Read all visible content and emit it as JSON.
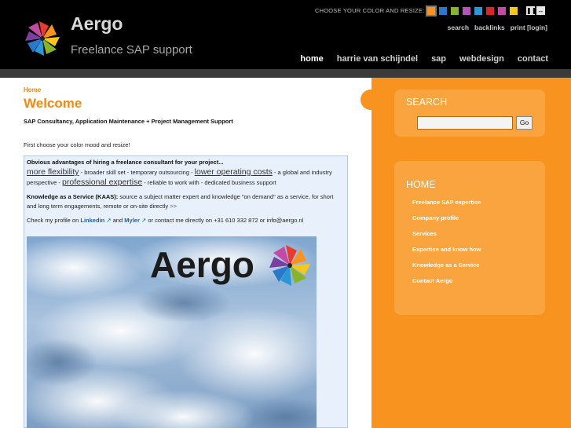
{
  "colors": {
    "accent": "#f7931e",
    "swatches": [
      "#f7931e",
      "#2a78c9",
      "#86b52a",
      "#b255b5",
      "#2a97d9",
      "#d4262b",
      "#c54aa3",
      "#f4c81c"
    ]
  },
  "header": {
    "site_title": "Aergo",
    "slogan": "Freelance SAP support",
    "color_label": "CHOOSE YOUR COLOR AND RESIZE:",
    "meta_nav": [
      "search",
      "backlinks",
      "print [login]"
    ],
    "main_nav": [
      "home",
      "harrie van schijndel",
      "sap",
      "webdesign",
      "contact"
    ]
  },
  "content": {
    "breadcrumb": "Home",
    "title": "Welcome",
    "subtitle": "SAP Consultancy, Application Maintenance + Project Management Support",
    "intro": "First choose your color mood and resize!",
    "adv_heading": "Obvious advantages of hiring a freelance consultant for your project...",
    "adv_flex": "more flexibility",
    "adv_t1": " - broader skill set - temporary outsourcing - ",
    "adv_costs": "lower operating costs",
    "adv_t2": " - a global and industry perspective - ",
    "adv_expertise": "professional expertise",
    "adv_t3": " - reliable to work with - dedicated business support",
    "kaas_label": "Knowledge as a Service (KAAS):",
    "kaas_text": " source a subject matter expert and knowledge \"on demand\" as a service, for short and long term engagements, remote or on-site directly ",
    "kaas_more": ">>",
    "profile_t1": "Check my profile on ",
    "linkedin": "Linkedin",
    "profile_and": " and ",
    "myler": "Myler",
    "profile_t2": " or contact me directly on +31 610 332 872 or info@aergo.nl",
    "image_wordmark": "Aergo"
  },
  "sidebar": {
    "search_title": "SEARCH",
    "search_value": "",
    "search_button": "Go",
    "menu_title": "HOME",
    "menu_items": [
      "Freelance SAP expertise",
      "Company profile",
      "Services",
      "Expertise and know how",
      "Knowledge as a Service",
      "Contact Aergo"
    ]
  }
}
